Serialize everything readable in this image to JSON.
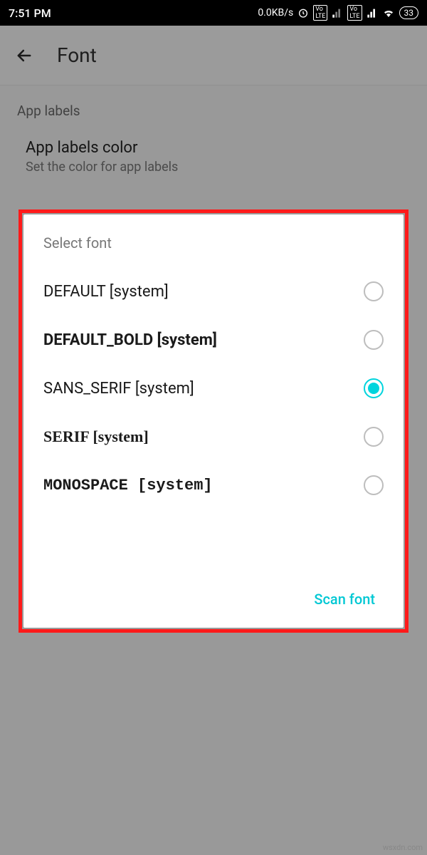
{
  "status": {
    "time": "7:51 PM",
    "net_speed": "0.0KB/s",
    "battery": "33"
  },
  "appbar": {
    "title": "Font"
  },
  "section": {
    "header": "App labels",
    "item_title": "App labels color",
    "item_sub": "Set the color for app labels"
  },
  "dialog": {
    "title": "Select font",
    "options": [
      {
        "label": "DEFAULT [system]",
        "style": "normal",
        "selected": false
      },
      {
        "label": "DEFAULT_BOLD [system]",
        "style": "bold",
        "selected": false
      },
      {
        "label": "SANS_SERIF [system]",
        "style": "normal",
        "selected": true
      },
      {
        "label": "SERIF [system]",
        "style": "serif",
        "selected": false
      },
      {
        "label": "MONOSPACE [system]",
        "style": "mono",
        "selected": false
      }
    ],
    "action": "Scan font"
  },
  "watermark": "wsxdn.com"
}
